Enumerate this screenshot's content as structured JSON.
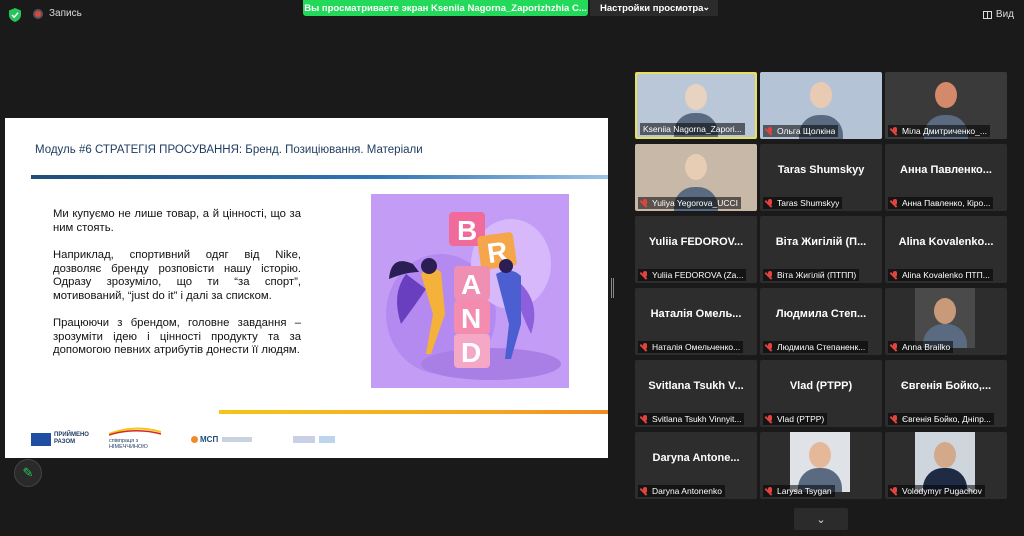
{
  "topbar": {
    "record_label": "Запись",
    "share_banner": "Вы просматриваете экран Kseniia Nagorna_Zaporizhzhia C...",
    "view_settings_label": "Настройки просмотра",
    "view_label": "Вид"
  },
  "slide": {
    "title": "Модуль #6 СТРАТЕГІЯ ПРОСУВАННЯ: Бренд. Позиціювання. Матеріали",
    "paragraphs": [
      "Ми купуємо не лише товар, а й цінності, що за ним стоять.",
      "Наприклад, спортивний одяг від Nike, дозволяє бренду розповісти нашу історію. Одразу зрозуміло, що ти “за спорт”, мотивований, “just do it” і далі за списком.",
      "Працюючи з брендом, головне завдання – зрозуміти ідею і цінності продукту та за допомогою певних атрибутів донести її людям."
    ],
    "brand_letters": [
      "B",
      "R",
      "A",
      "N",
      "D"
    ],
    "logos": [
      "ПРИЙМЕНО РАЗОМ",
      "співпраця з НІМЕЧЧИНОЮ",
      "МСП"
    ]
  },
  "participants": [
    {
      "big": "",
      "label": "Kseniia Nagorna_Zapori...",
      "muted": false,
      "active": true,
      "photo": true
    },
    {
      "big": "",
      "label": "Ольга Щолкіна",
      "muted": true,
      "active": false,
      "photo": true
    },
    {
      "big": "",
      "label": "Міла Дмитриченко_...",
      "muted": true,
      "active": false,
      "photo": true
    },
    {
      "big": "",
      "label": "Yuliya Yegorova_UCCI",
      "muted": true,
      "active": false,
      "photo": true
    },
    {
      "big": "Taras Shumskyy",
      "label": "Taras Shumskyy",
      "muted": true,
      "active": false,
      "photo": false
    },
    {
      "big": "Анна Павленко...",
      "label": "Анна Павленко, Кіро...",
      "muted": true,
      "active": false,
      "photo": false
    },
    {
      "big": "Yuliia FEDOROV...",
      "label": "Yuliia FEDOROVA (Za...",
      "muted": true,
      "active": false,
      "photo": false
    },
    {
      "big": "Віта Жигілій (П...",
      "label": "Віта Жигілій (ПТПП)",
      "muted": true,
      "active": false,
      "photo": false
    },
    {
      "big": "Alina Kovalenko...",
      "label": "Alina Kovalenko ПТП...",
      "muted": true,
      "active": false,
      "photo": false
    },
    {
      "big": "Наталія Омель...",
      "label": "Наталія Омельченко...",
      "muted": true,
      "active": false,
      "photo": false
    },
    {
      "big": "Людмила Степ...",
      "label": "Людмила Степаненк...",
      "muted": true,
      "active": false,
      "photo": false
    },
    {
      "big": "",
      "label": "Anna Brailko",
      "muted": true,
      "active": false,
      "photo": true
    },
    {
      "big": "Svitlana Tsukh V...",
      "label": "Svitlana Tsukh Vinnyit...",
      "muted": true,
      "active": false,
      "photo": false
    },
    {
      "big": "Vlad (PTPP)",
      "label": "Vlad (PTPP)",
      "muted": true,
      "active": false,
      "photo": false
    },
    {
      "big": "Євгенія Бойко,...",
      "label": "Євгенія Бойко, Дніпр...",
      "muted": true,
      "active": false,
      "photo": false
    },
    {
      "big": "Daryna Antone...",
      "label": "Daryna Antonenko",
      "muted": true,
      "active": false,
      "photo": false
    },
    {
      "big": "",
      "label": "Larysa Tsygan",
      "muted": true,
      "active": false,
      "photo": true
    },
    {
      "big": "",
      "label": "Volodymyr Pugachov",
      "muted": true,
      "active": false,
      "photo": true
    }
  ],
  "colors": {
    "share_green": "#23d959",
    "active_border": "#e8e05c",
    "mute_red": "#e0443e",
    "slide_blue": "#1f4e79",
    "slide_yellow": "#f5c518"
  }
}
